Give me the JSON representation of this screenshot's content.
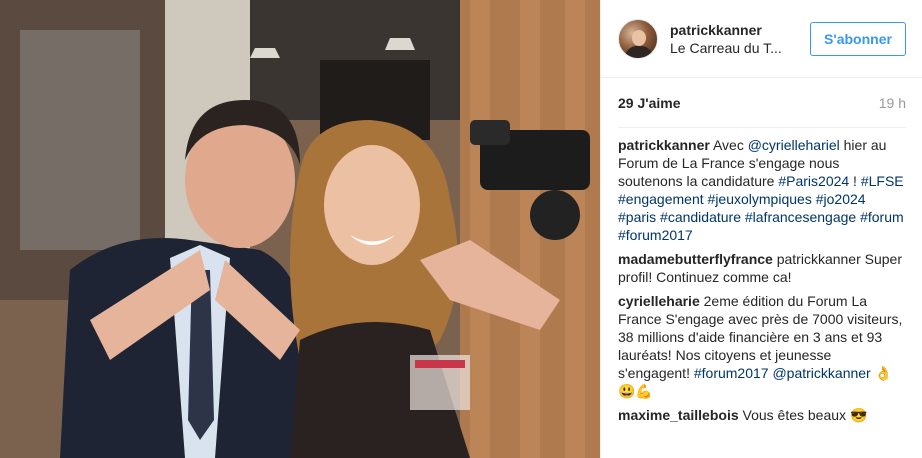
{
  "header": {
    "username": "patrickkanner",
    "location": "Le Carreau du T...",
    "follow_label": "S'abonner"
  },
  "stats": {
    "likes": "29 J'aime",
    "time": "19 h"
  },
  "caption": {
    "author": "patrickkanner",
    "parts": {
      "p0": " Avec ",
      "m0": "@cyriellehariel",
      "p1": " hier au Forum de La France s'engage nous soutenons la candidature ",
      "h0": "#Paris2024",
      "p2": " !",
      "h1": "#LFSE",
      "h2": "#engagement",
      "h3": "#jeuxolympiques",
      "h4": "#jo2024",
      "h5": "#paris",
      "h6": "#candidature",
      "h7": "#lafrancesengage",
      "h8": "#forum",
      "h9": "#forum2017"
    }
  },
  "comments": [
    {
      "author": "madamebutterflyfrance",
      "text": " patrickkanner Super profil! Continuez comme ca!"
    },
    {
      "author": "cyrielleharie",
      "text": " 2eme édition du Forum La France S'engage avec près de 7000 visiteurs, 38 millions d'aide financière en 3 ans et 93 lauréats! Nos citoyens et jeunesse s'engagent! ",
      "hashtag": "#forum2017",
      "mention": "@patrickkanner",
      "emojis": "👌😃💪"
    },
    {
      "author": "maxime_taillebois",
      "text": " Vous êtes beaux ",
      "emoji": "😎"
    }
  ]
}
